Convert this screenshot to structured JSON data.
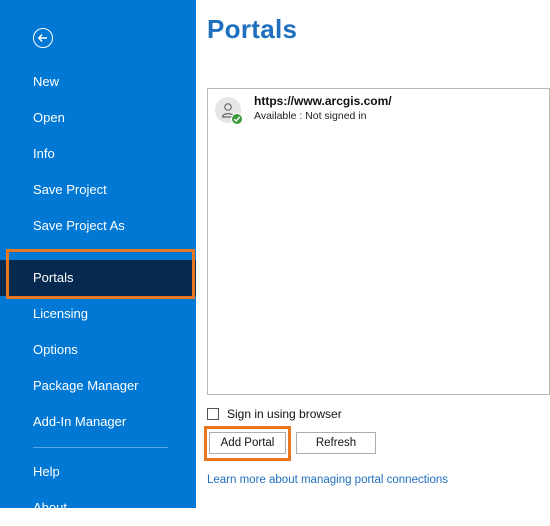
{
  "sidebar": {
    "back_icon": "back-arrow-circle-icon",
    "items": [
      {
        "label": "New"
      },
      {
        "label": "Open"
      },
      {
        "label": "Info"
      },
      {
        "label": "Save Project"
      },
      {
        "label": "Save Project As"
      },
      {
        "label": "Portals",
        "active": true
      },
      {
        "label": "Licensing"
      },
      {
        "label": "Options"
      },
      {
        "label": "Package Manager"
      },
      {
        "label": "Add-In Manager"
      },
      {
        "label": "Help"
      },
      {
        "label": "About"
      }
    ]
  },
  "main": {
    "title": "Portals",
    "portals": [
      {
        "url": "https://www.arcgis.com/",
        "status": "Available : Not signed in",
        "icon": "user-avatar-icon",
        "status_icon": "checkmark-icon"
      }
    ],
    "sign_in_browser_label": "Sign in using browser",
    "sign_in_browser_checked": false,
    "add_portal_label": "Add Portal",
    "refresh_label": "Refresh",
    "learn_more_link": "Learn more about managing portal connections"
  },
  "colors": {
    "sidebar_bg": "#0078d4",
    "active_item_bg": "#062a4f",
    "highlight": "#e87722",
    "title": "#1f6fbf"
  }
}
